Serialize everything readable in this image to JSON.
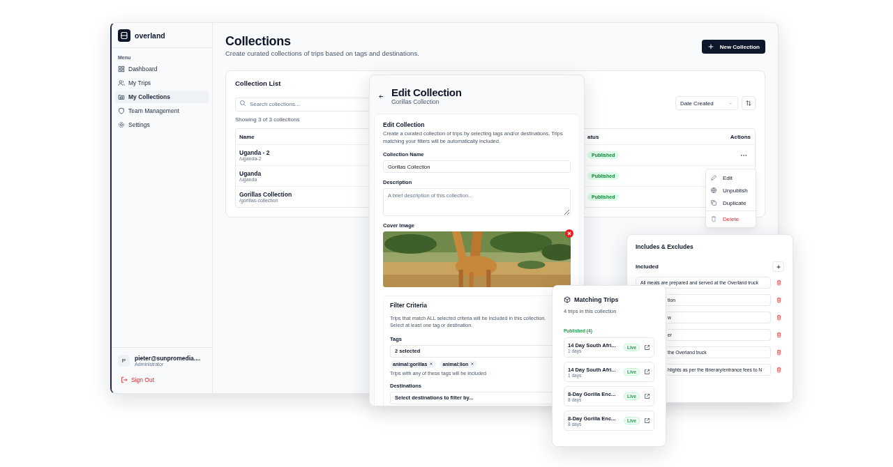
{
  "app": {
    "brand": "overland",
    "menu_label": "Menu",
    "nav": [
      {
        "label": "Dashboard",
        "selected": false
      },
      {
        "label": "My Trips",
        "selected": false
      },
      {
        "label": "My Collections",
        "selected": true
      },
      {
        "label": "Team Management",
        "selected": false
      },
      {
        "label": "Settings",
        "selected": false
      }
    ],
    "user": {
      "initial": "P",
      "email": "pieter@sunpromedia....",
      "role": "Administrator"
    },
    "sign_out": "Sign Out"
  },
  "page": {
    "title": "Collections",
    "subtitle": "Create curated collections of trips based on tags and destinations.",
    "new_button": "New Collection"
  },
  "collection_list": {
    "title": "Collection List",
    "search_placeholder": "Search collections...",
    "sort": "Date Created",
    "count": "Showing 3 of 3 collections",
    "columns": [
      "Name",
      "atus",
      "Actions"
    ],
    "rows": [
      {
        "name": "Uganda - 2",
        "slug": "/uganda-2",
        "status": "Published"
      },
      {
        "name": "Uganda",
        "slug": "/uganda",
        "status": "Published"
      },
      {
        "name": "Gorillas Collection",
        "slug": "/gorillas-collection",
        "status": "Published"
      }
    ],
    "menu": [
      {
        "label": "Edit",
        "kind": "normal"
      },
      {
        "label": "Unpublish",
        "kind": "normal"
      },
      {
        "label": "Duplicate",
        "kind": "normal"
      },
      {
        "label": "Delete",
        "kind": "danger"
      }
    ]
  },
  "edit": {
    "title": "Edit Collection",
    "subtitle": "Gorillas Collection",
    "card_title": "Edit Collection",
    "card_description": "Create a curated collection of trips by selecting tags and/or destinations. Trips matching your filters will be automatically included.",
    "name_label": "Collection Name",
    "name_value": "Gorillas Collection",
    "description_label": "Description",
    "description_placeholder": "A brief description of this collection...",
    "cover_label": "Cover Image",
    "filter": {
      "title": "Filter Criteria",
      "description": "Trips that match ALL selected criteria will be included in this collection. Select at least one tag or destination.",
      "tags_label": "Tags",
      "tags_value": "2 selected",
      "tags": [
        "animal:gorillas",
        "animal:lion"
      ],
      "tags_hint": "Trips with any of these tags will be included",
      "destinations_label": "Destinations",
      "destinations_placeholder": "Select destinations to filter by..."
    }
  },
  "matching": {
    "title": "Matching Trips",
    "count": "4 trips in this collection",
    "group": "Published (4)",
    "trips": [
      {
        "name": "14 Day South Afri...",
        "duration": "1 days",
        "status": "Live"
      },
      {
        "name": "14 Day South Afri...",
        "duration": "1 days",
        "status": "Live"
      },
      {
        "name": "8-Day Gorilla Enc...",
        "duration": "8 days",
        "status": "Live"
      },
      {
        "name": "8-Day Gorilla Enc...",
        "duration": "8 days",
        "status": "Live"
      }
    ]
  },
  "includes": {
    "title": "Includes & Excludes",
    "included_label": "Included",
    "items": [
      "All meals are prepared and served at the Overland truck",
      "tion",
      "w",
      "er",
      "the Overland truck",
      "hlights as per the itinerary/entrance fees to N"
    ]
  }
}
